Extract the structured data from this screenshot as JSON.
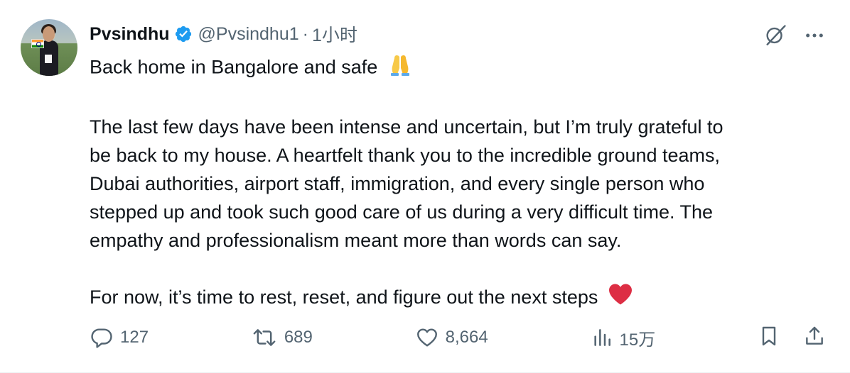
{
  "tweet": {
    "author_name": "Pvsindhu",
    "handle": "@Pvsindhu1",
    "separator": "·",
    "time": "1小时",
    "paragraphs": [
      "Back home in Bangalore and safe",
      "The last few days have been intense and uncertain, but I’m truly grateful to",
      "be back to my house. A heartfelt thank you to the incredible ground teams,",
      "Dubai authorities, airport staff, immigration, and every single person who",
      "stepped up and took such good care of us during a very difficult time. The",
      "empathy and professionalism meant more than words can say.",
      "For now, it’s time to rest, reset, and figure out the next steps"
    ],
    "emojis": {
      "first": "folded-hands-emoji",
      "last": "red-heart-emoji"
    }
  },
  "stats": {
    "replies": "127",
    "reposts": "689",
    "likes": "8,664",
    "views": "15万"
  },
  "colors": {
    "text": "#0f1419",
    "muted": "#536471",
    "verified": "#1d9bf0",
    "heart": "#e0245e"
  },
  "icons": {
    "verified": "verified-badge-icon",
    "grok": "grok-icon",
    "more": "more-icon",
    "reply": "reply-icon",
    "repost": "repost-icon",
    "like": "like-icon",
    "views": "views-icon",
    "bookmark": "bookmark-icon",
    "share": "share-icon"
  }
}
